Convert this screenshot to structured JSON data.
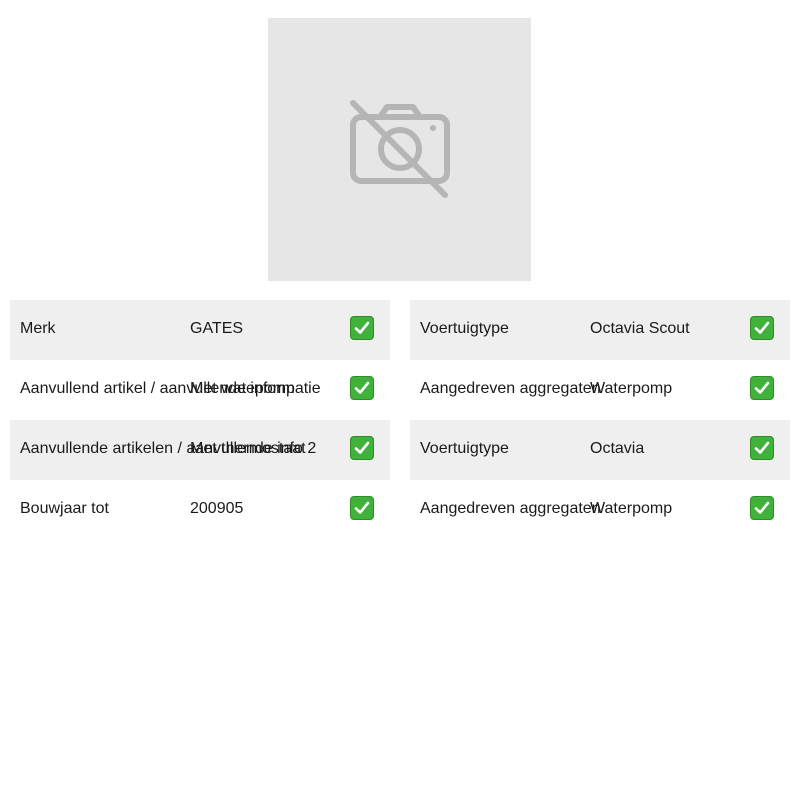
{
  "image": {
    "icon": "no-photo-icon"
  },
  "left_rows": [
    {
      "label": "Merk",
      "value": "GATES"
    },
    {
      "label": "Aanvullend artikel / aanvullende informatie",
      "value": "Met watepomp"
    },
    {
      "label": "Aanvullende artikelen / aanvullende info 2",
      "value": "Met thermostaat"
    },
    {
      "label": "Bouwjaar tot",
      "value": "200905"
    }
  ],
  "right_rows": [
    {
      "label": "Voertuigtype",
      "value": "Octavia Scout"
    },
    {
      "label": "Aangedreven aggregaten",
      "value": "Waterpomp"
    },
    {
      "label": "Voertuigtype",
      "value": "Octavia"
    },
    {
      "label": "Aangedreven aggregaten",
      "value": "Waterpomp"
    }
  ],
  "colors": {
    "check": "#3fb23a",
    "row_shade": "#efefef",
    "image_bg": "#e6e6e6"
  }
}
